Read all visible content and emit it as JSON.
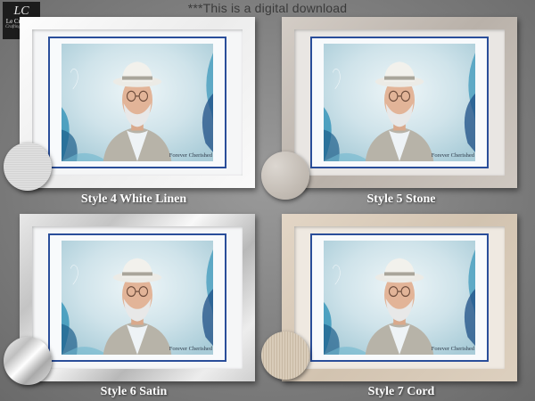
{
  "banner": "***This is a digital download",
  "logo": {
    "monogram": "LC",
    "name": "Le Crystelle",
    "tagline": "Crafting & Crafts"
  },
  "frames": [
    {
      "label": "Style 4 White Linen",
      "caption": "Forever Cherished",
      "swatch": "white-linen-texture"
    },
    {
      "label": "Style 5 Stone",
      "caption": "Forever Cherished",
      "swatch": "stone-texture"
    },
    {
      "label": "Style 6 Satin",
      "caption": "Forever Cherished",
      "swatch": "satin-texture"
    },
    {
      "label": "Style 7 Cord",
      "caption": "Forever Cherished",
      "swatch": "cord-texture"
    }
  ],
  "colors": {
    "accent_border": "#2a4e9a",
    "photo_bg": "#cfe3ea",
    "watercolor": "#2a8fb5"
  }
}
